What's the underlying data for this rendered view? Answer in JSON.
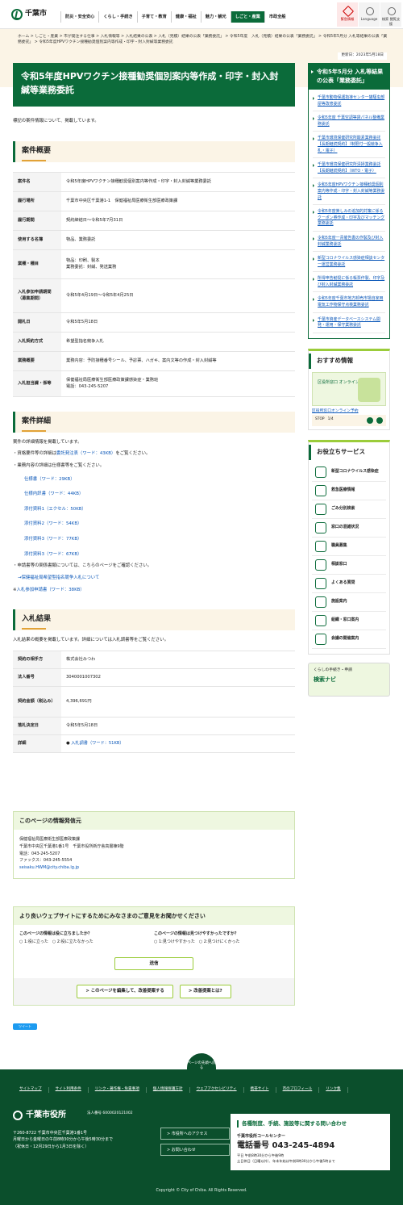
{
  "header": {
    "logo": "千葉市",
    "nav": [
      "防災・安全安心",
      "くらし・手続き",
      "子育て・教育",
      "健康・福祉",
      "魅力・観光",
      "しごと・産業",
      "市政全般"
    ],
    "util": [
      "緊急情報",
      "Language",
      "検索 閲覧支援"
    ]
  },
  "breadcrumb": "ホーム > しごと・産業 > 市が発注する仕事 > 入札情報等 > 入札結果の公表 > 入札（見積）結果の公表「業務委託」 > 令和5年度　入札（見積）結果の公表「業務委託」 > 令和5年5月分 入札等結果の公表「業務委託」 > 令和5年度HPVワクチン接種勧奨個別案内等作成・印字・封入封緘等業務委託",
  "updated": "更新日：2023年5月18日",
  "title": "令和5年度HPVワクチン接種勧奨個別案内等作成・印字・封入封緘等業務委託",
  "intro": "標記の案件情報について、掲載しています。",
  "gaiyo": {
    "heading": "案件概要",
    "rows": [
      {
        "k": "案件名",
        "v": "令和5年度HPVワクチン接種勧奨個別案内等作成・印字・封入封緘等業務委託"
      },
      {
        "k": "履行場所",
        "v": "千葉市中央区千葉港1-1　保健福祉局医療衛生部医療政策課"
      },
      {
        "k": "履行期間",
        "v": "契約締結日～令和5年7月31日"
      },
      {
        "k": "使用する名簿",
        "v": "物品、業務委託"
      },
      {
        "k": "業種・種目",
        "v": "物品：印刷、製本\n業務委託：封緘、発送業務"
      },
      {
        "k": "入札参加申請期間（募集期間）",
        "v": "令和5年4月19日～令和5年4月25日"
      },
      {
        "k": "開札日",
        "v": "令和5年5月18日"
      },
      {
        "k": "入札契約方式",
        "v": "希望型指名競争入札"
      },
      {
        "k": "業務概要",
        "v": "業務内容：予防接種番号シール、予診票、ハガキ、案内文等の作成・封入封緘等"
      },
      {
        "k": "入札担当課・係等",
        "v": "保健福祉局医療衛生部医療政策課感染症・業務班\n電話：043-245-5207"
      }
    ]
  },
  "shosai": {
    "heading": "案件詳細",
    "p1": "案件の詳細情報を掲載しています。",
    "p2": "・資格要件等の詳細は",
    "p2link": "委託発注表（ワード：43KB）",
    "p2tail": "をご覧ください。",
    "p3": "・業務内容の詳細は仕様書等をご覧ください。",
    "links": [
      "仕様書（ワード：29KB）",
      "仕様内訳書（ワード：44KB）",
      "添付資料1（エクセル：50KB）",
      "添付資料2（ワード：54KB）",
      "添付資料3（ワード：77KB）",
      "添付資料3（ワード：67KB）"
    ],
    "p4": "・申請書等の関係書類については、こちらのページをご確認ください。",
    "p4link": "→保健福祉局希望型指名競争入札について",
    "p5pre": "※",
    "p5link": "入札参加申請書（ワード：38KB）"
  },
  "kekka": {
    "heading": "入札結果",
    "p": "入札結果の概要を掲載しています。詳細については入札調書等をご覧ください。",
    "rows": [
      {
        "k": "契約の相手方",
        "v": "株式会社みつわ"
      },
      {
        "k": "法人番号",
        "v": "3040001007302"
      },
      {
        "k": "契約金額（税込み）",
        "v": "4,396,691円"
      },
      {
        "k": "落札決定日",
        "v": "令和5年5月18日"
      },
      {
        "k": "詳細",
        "v": "入札調書（ワード：51KB）"
      }
    ]
  },
  "sidebar": {
    "heading": "令和5年5月分 入札等結果の公表「業務委託」",
    "items": [
      "千葉市動物保護指導センター猫駆虫部屋等改修委託",
      "令和5年度 千葉空調等貸パネル整備業務委託",
      "千葉市環境保健研究所酸素業務委託【長期継続契約】（制限付一般競争入札・電子）",
      "千葉市環境保健研究所清掃業務委託【長期継続契約】（WTO・電子）",
      "令和5年度HPVワクチン接種勧奨個別案内等作成・印字・封入封緘等業務委託",
      "令和5年度楽しみの追加的対策に係るクーポン券作成・印字及びマッチング業務委託",
      "令和5年度一青催告書の作製及び封入封緘業務委託",
      "新型コロナウイルス感染症相談センター運営業務委託",
      "所得申告勧奨に係る帳票作製、印字及び封入封緘業務委託",
      "令和5年度千葉市地方卸売市場自家用電気工作物保守点検業務委託",
      "千葉市資産データベースシステム開発・運用・保守業務委託"
    ]
  },
  "osusume": {
    "heading": "おすすめ情報",
    "banner": "区役所窓口 オンライン予約",
    "link": "区役所窓口オンライン予約",
    "ctrl": "STOP",
    "page": "1/4"
  },
  "services": {
    "heading": "お役立ちサービス",
    "items": [
      "新型コロナウイルス感染症",
      "救急医療情報",
      "ごみ分別検索",
      "窓口の混雑状況",
      "職員募集",
      "相談窓口",
      "よくある質問",
      "施設案内",
      "組織・窓口案内",
      "会議の開催案内"
    ]
  },
  "navi": {
    "small": "くらしの手続き・申請",
    "big": "検索ナビ"
  },
  "hasshin": {
    "heading": "このページの情報発信元",
    "lines": [
      "保健福祉局医療衛生部医療政策課",
      "千葉市中央区千葉港1番1号　千葉市役所新庁舎高層棟9階",
      "電話：043-245-5207",
      "ファックス：043-245-5554"
    ],
    "mail": "seisaku.HWM@city.chiba.lg.jp"
  },
  "feedback": {
    "heading": "より良いウェブサイトにするためにみなさまのご意見をお聞かせください",
    "q1": "このページの情報は役に立ちましたか？",
    "q1o": "○ 1:役に立った　○ 2:役に立たなかった",
    "q2": "このページの情報は見つけやすかったですか？",
    "q2o": "○ 1:見つけやすかった　○ 2:見つけにくかった",
    "send": "送信",
    "btn1": "> このページを編集して、改善提案する",
    "btn2": "> 改善提案とは?"
  },
  "tweet": "ツイート",
  "pagetop": "ページの先頭へ戻る",
  "footer": {
    "links": [
      "サイトマップ",
      "サイト利用条件",
      "リンク・著作権・免責事項",
      "個人情報保護方針",
      "ウェブアクセシビリティ",
      "携帯サイト",
      "市のプロフィール",
      "リンク集"
    ],
    "name": "千葉市役所",
    "corp": "法人番号 6000020121002",
    "addr": "〒260-8722 千葉市中央区千葉港1番1号\n月曜日から金曜日の午前8時30分から午後5時30分まで\n（祝休日・12月29日から1月3日を除く）",
    "b1": "> 市役所へのアクセス",
    "b2": "> お問い合わせ",
    "cc_h": "各種制度、手続、施設等に関する問い合わせ",
    "cc_s": "千葉市役所コールセンター",
    "cc_tel": "電話番号 043-245-4894",
    "cc_m": "平日 午前8時30分から午後9時\n土日休日（日曜以外）、年末年始は午前8時30分から午後5時まで",
    "copy": "Copyright © City of Chiba. All Rights Reserved."
  },
  "colors": {
    "brand": "#0b6b3a",
    "accent": "#e2a237",
    "cream": "#fbf4e6"
  }
}
